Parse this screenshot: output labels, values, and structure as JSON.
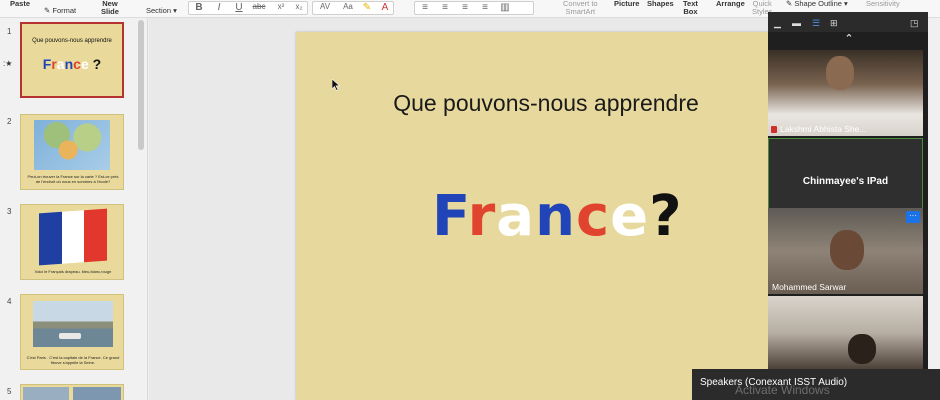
{
  "ribbon": {
    "paste": "Paste",
    "format": "Format",
    "new_slide_1": "New",
    "new_slide_2": "Slide",
    "section": "Section",
    "convert_1": "Convert to",
    "convert_2": "SmartArt",
    "picture": "Picture",
    "shapes": "Shapes",
    "text_box_1": "Text",
    "text_box_2": "Box",
    "arrange": "Arrange",
    "quick_styles_1": "Quick",
    "quick_styles_2": "Styles",
    "shape_outline": "Shape Outline",
    "sensitivity": "Sensitivity",
    "bold": "B",
    "italic": "I",
    "underline": "U",
    "strike": "abc"
  },
  "slides": {
    "numbers": [
      "1",
      "2",
      "3",
      "4",
      "5"
    ],
    "s1_title": "Que pouvons-nous apprendre",
    "s1_word": "France?",
    "s2_caption": "Peut-on trouver la France sur la carte ? Est-ce près de l'endroit où nous en sommes à l'école?",
    "s3_caption": "Voici le Français drapeau. bleu,blanc,rouge",
    "s4_caption": "C'est Paris . C'est la capitale de la France. Ce grand fleuve s'appelle la Seine."
  },
  "slide": {
    "title": "Que pouvons-nous apprendre",
    "letters": [
      {
        "ch": "F",
        "color": "#2145b8"
      },
      {
        "ch": "r",
        "color": "#e0442f"
      },
      {
        "ch": "a",
        "color": "#ffffff"
      },
      {
        "ch": "n",
        "color": "#2145b8"
      },
      {
        "ch": "c",
        "color": "#e0442f"
      },
      {
        "ch": "e",
        "color": "#ffffff"
      },
      {
        "ch": "?",
        "color": "#111111"
      }
    ]
  },
  "participants": [
    {
      "name": "Lakshmi Abhista She...",
      "type": "video",
      "muted": true
    },
    {
      "name": "Chinmayee's IPad",
      "type": "name-only",
      "active_speaker": true
    },
    {
      "name": "Mohammed Sarwar",
      "type": "video",
      "more_label": "···"
    },
    {
      "name": "",
      "type": "video"
    }
  ],
  "taskbar": {
    "audio": "Speakers (Conexant ISST Audio)",
    "watermark": "Activate Windows"
  },
  "colors": {
    "slide_bg": "#e7d99d",
    "selected_border": "#b5322f",
    "flag_blue": "#1f3fa3",
    "flag_white": "#ffffff",
    "flag_red": "#e1372c",
    "zoom_blue": "#1a73e8"
  }
}
